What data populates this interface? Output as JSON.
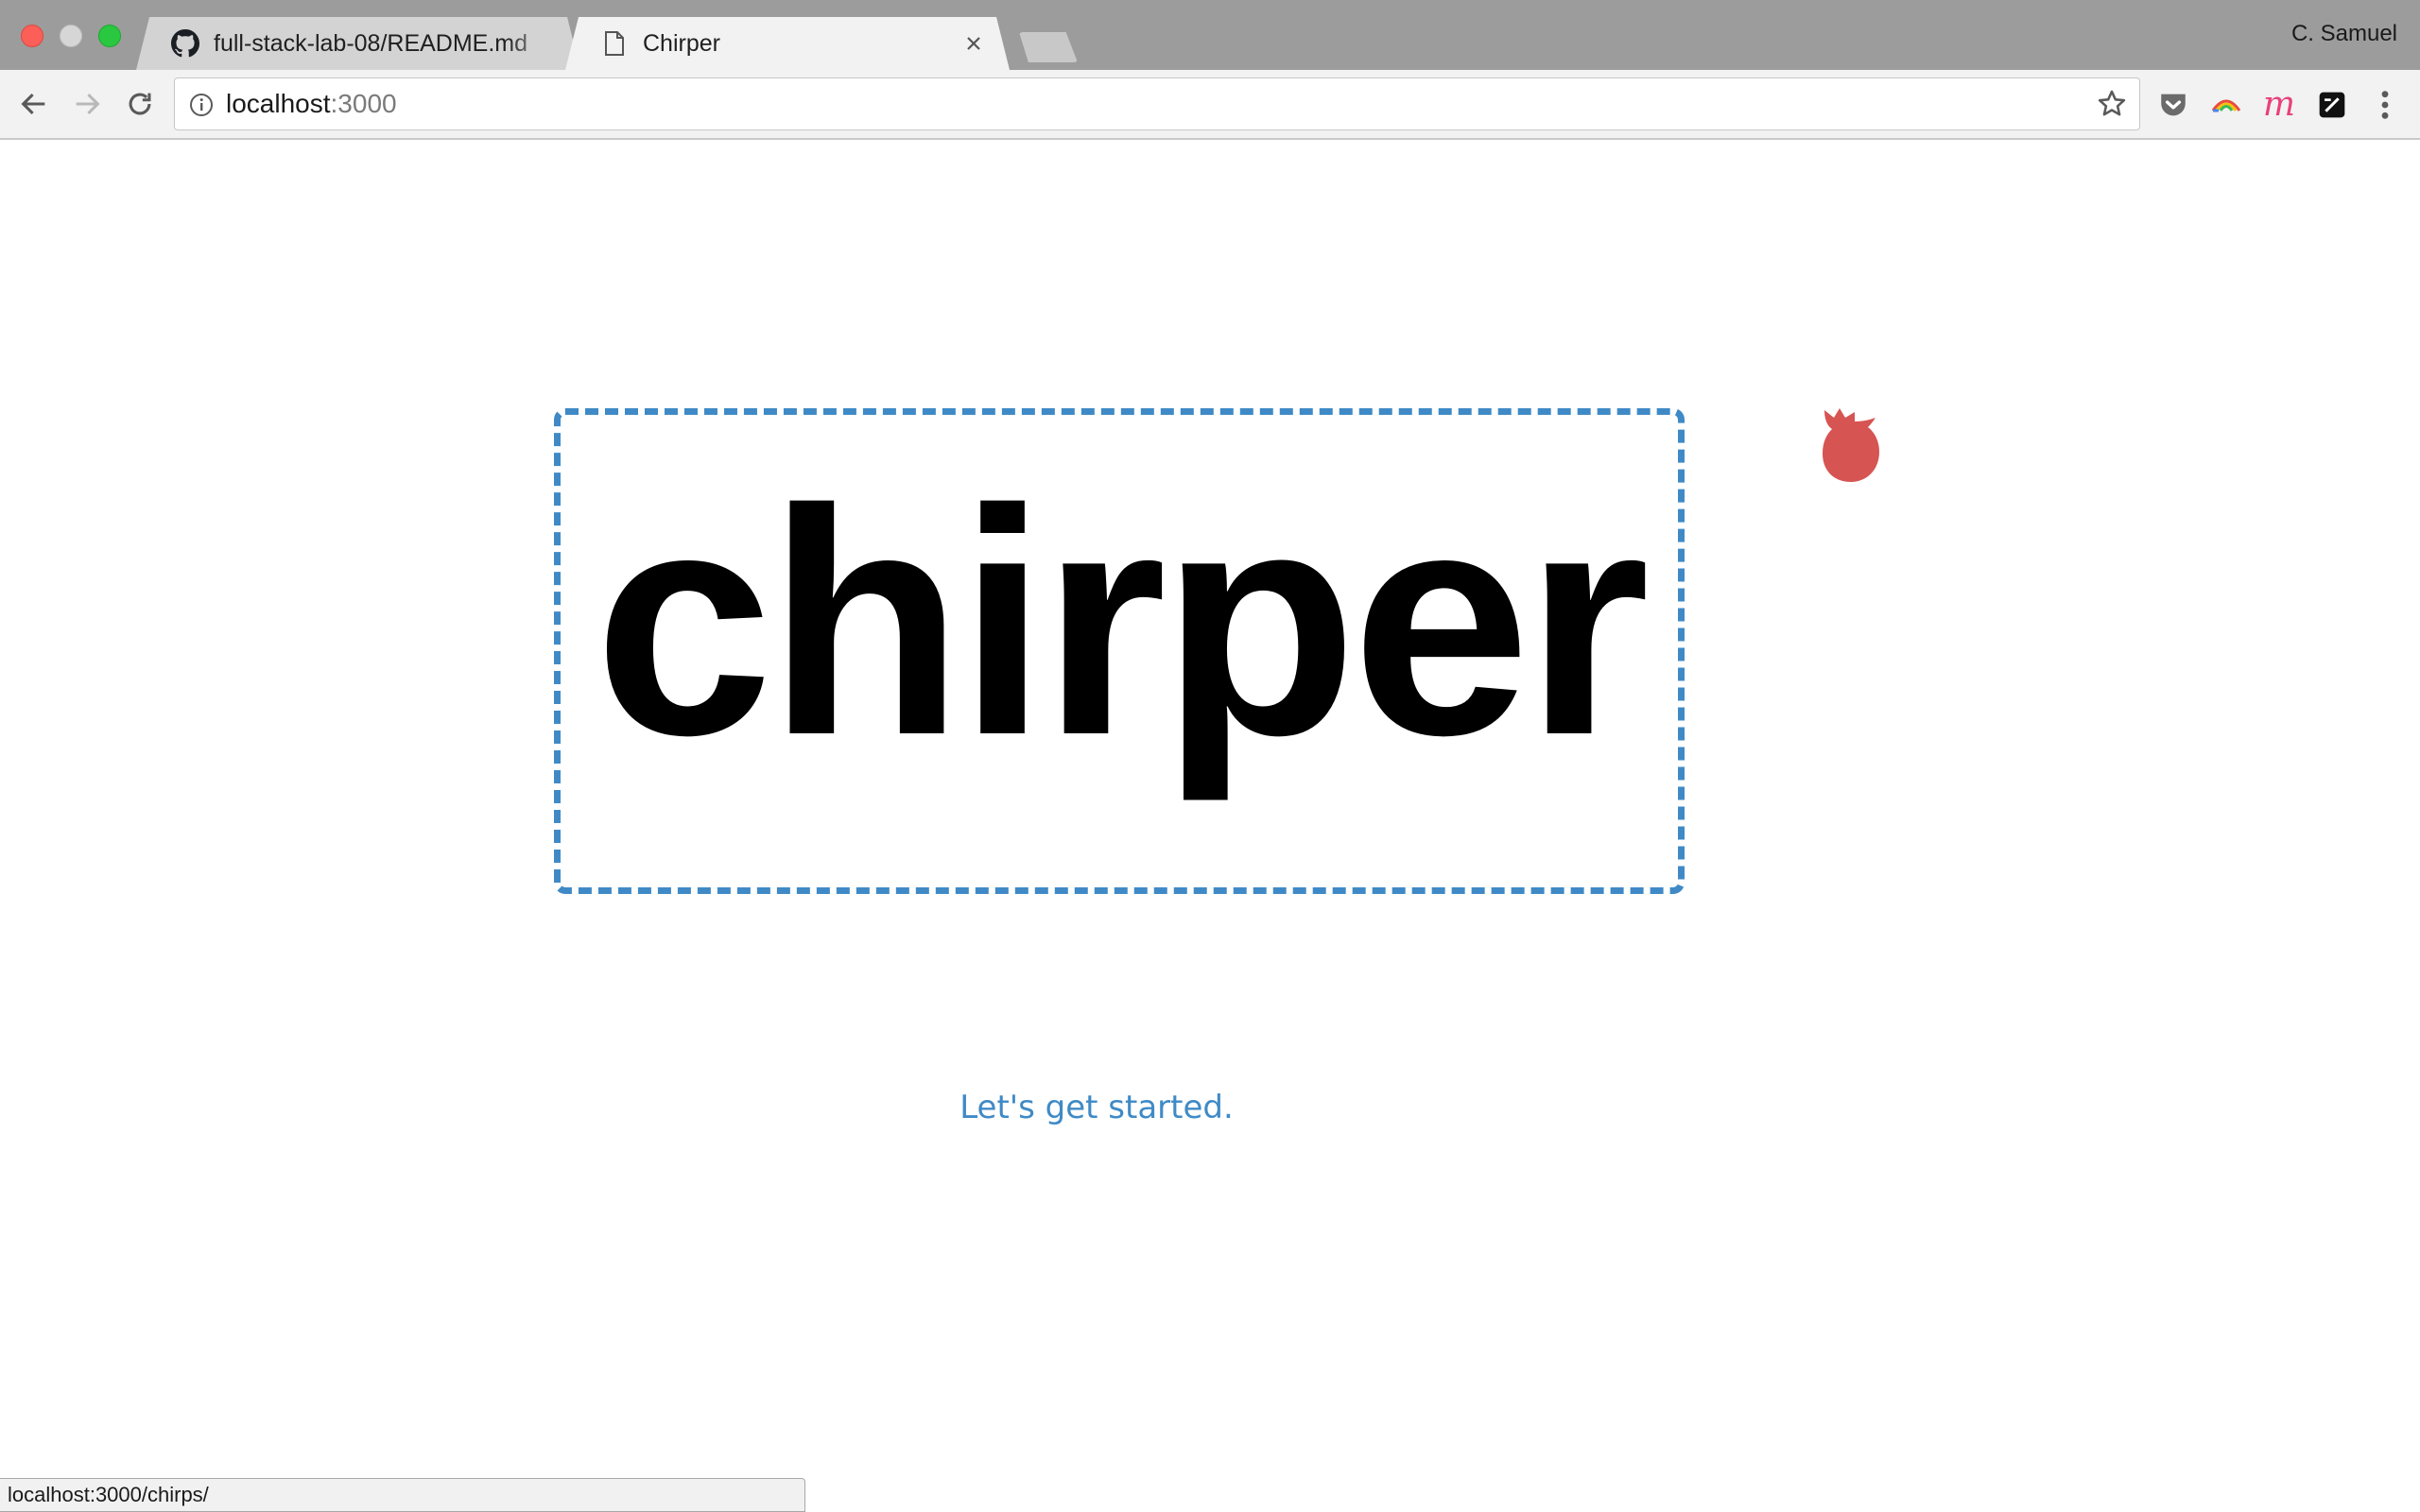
{
  "browser": {
    "tabs": [
      {
        "title": "full-stack-lab-08/README.md",
        "favicon": "github-icon",
        "active": false
      },
      {
        "title": "Chirper",
        "favicon": "document-icon",
        "active": true
      }
    ],
    "profile_name": "C. Samuel",
    "url_host": "localhost",
    "url_port": ":3000",
    "status_url": "localhost:3000/chirps/",
    "extensions": [
      "pocket-icon",
      "rainbow-extension-icon",
      "m-extension-icon",
      "notes-extension-icon"
    ]
  },
  "page": {
    "logo_text": "chirper",
    "cta": "Let's get started.",
    "colors": {
      "accent": "#3f8ac6",
      "bird": "#d65452",
      "logo": "#000000"
    }
  }
}
